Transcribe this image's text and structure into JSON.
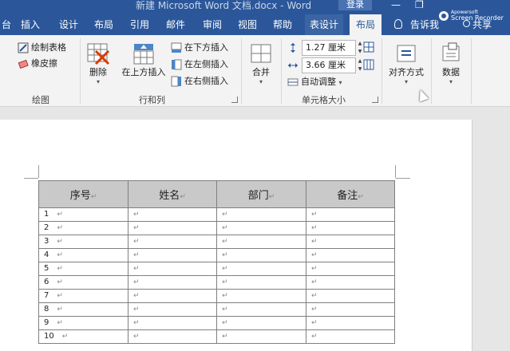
{
  "window": {
    "title": "新建 Microsoft Word 文档.docx  -  Word",
    "login_label": "登录",
    "minimize_glyph": "—",
    "restore_glyph": "❐"
  },
  "tabs": [
    {
      "label": "台"
    },
    {
      "label": "插入"
    },
    {
      "label": "设计"
    },
    {
      "label": "布局"
    },
    {
      "label": "引用"
    },
    {
      "label": "邮件"
    },
    {
      "label": "审阅"
    },
    {
      "label": "视图"
    },
    {
      "label": "帮助"
    },
    {
      "label": "表设计"
    },
    {
      "label": "布局"
    }
  ],
  "tell_me": {
    "label": "告诉我",
    "icon": "lightbulb-icon"
  },
  "share": {
    "label": "共享",
    "icon": "person-icon"
  },
  "recorder": {
    "line1": "Apowersoft",
    "line2": "Screen Recorder"
  },
  "ribbon": {
    "draw": {
      "draw_table": "绘制表格",
      "eraser": "橡皮擦",
      "group_label": "绘图"
    },
    "rows_cols": {
      "delete": "删除",
      "insert_above": "在上方插入",
      "insert_below": "在下方插入",
      "insert_left": "在左侧插入",
      "insert_right": "在右侧插入",
      "group_label": "行和列"
    },
    "merge": {
      "label": "合并"
    },
    "cell_size": {
      "height": "1.27 厘米",
      "width": "3.66 厘米",
      "autofit": "自动调整",
      "group_label": "单元格大小"
    },
    "alignment": {
      "label": "对齐方式"
    },
    "data": {
      "label": "数据"
    }
  },
  "colors": {
    "brand": "#2b579a",
    "ribbon_bg": "#f3f3f3",
    "table_header": "#c9c9c9"
  },
  "table": {
    "headers": [
      "序号",
      "姓名",
      "部门",
      "备注"
    ],
    "cell_mark": "↵",
    "rows": [
      "1",
      "2",
      "3",
      "4",
      "5",
      "6",
      "7",
      "8",
      "9",
      "10"
    ]
  }
}
